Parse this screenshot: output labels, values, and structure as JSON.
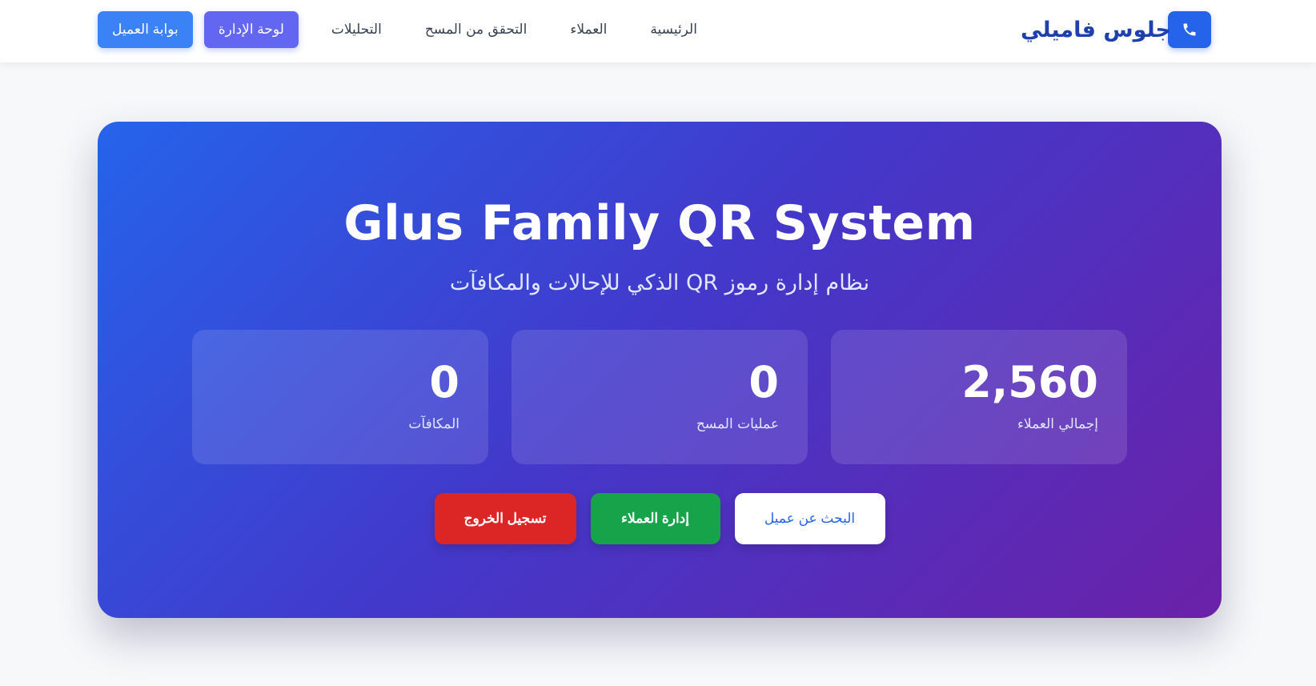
{
  "brand": {
    "name": "جلوس فاميلي",
    "icon": "phone-icon",
    "accent_color": "#2563eb"
  },
  "nav": {
    "links": [
      {
        "label": "الرئيسية"
      },
      {
        "label": "العملاء"
      },
      {
        "label": "التحقق من المسح"
      },
      {
        "label": "التحليلات"
      }
    ],
    "admin_button": "لوحة الإدارة",
    "portal_button": "بوابة العميل"
  },
  "hero": {
    "title": "Glus Family QR System",
    "subtitle": "نظام إدارة رموز QR الذكي للإحالات والمكافآت",
    "gradient_colors": [
      "#2563eb",
      "#4338ca",
      "#6b21a8"
    ]
  },
  "stats": [
    {
      "value": "2,560",
      "label": "إجمالي العملاء"
    },
    {
      "value": "0",
      "label": "عمليات المسح"
    },
    {
      "value": "0",
      "label": "المكافآت"
    }
  ],
  "actions": {
    "search": "البحث عن عميل",
    "manage": "إدارة العملاء",
    "logout": "تسجيل الخروج",
    "colors": {
      "search": "#ffffff",
      "manage": "#16a34a",
      "logout": "#dc2626"
    }
  }
}
